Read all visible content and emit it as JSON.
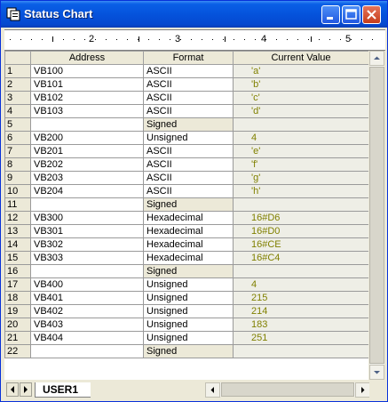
{
  "window": {
    "title": "Status Chart"
  },
  "ruler": {
    "labels": [
      "2",
      "3",
      "4",
      "5"
    ]
  },
  "grid": {
    "headers": [
      "Address",
      "Format",
      "Current Value"
    ],
    "rows": [
      {
        "n": "1",
        "address": "VB100",
        "format": "ASCII",
        "value": "'a'"
      },
      {
        "n": "2",
        "address": "VB101",
        "format": "ASCII",
        "value": "'b'"
      },
      {
        "n": "3",
        "address": "VB102",
        "format": "ASCII",
        "value": "'c'"
      },
      {
        "n": "4",
        "address": "VB103",
        "format": "ASCII",
        "value": "'d'"
      },
      {
        "n": "5",
        "address": "",
        "format": "Signed",
        "value": ""
      },
      {
        "n": "6",
        "address": "VB200",
        "format": "Unsigned",
        "value": "4"
      },
      {
        "n": "7",
        "address": "VB201",
        "format": "ASCII",
        "value": "'e'"
      },
      {
        "n": "8",
        "address": "VB202",
        "format": "ASCII",
        "value": "'f'"
      },
      {
        "n": "9",
        "address": "VB203",
        "format": "ASCII",
        "value": "'g'"
      },
      {
        "n": "10",
        "address": "VB204",
        "format": "ASCII",
        "value": "'h'"
      },
      {
        "n": "11",
        "address": "",
        "format": "Signed",
        "value": ""
      },
      {
        "n": "12",
        "address": "VB300",
        "format": "Hexadecimal",
        "value": "16#D6"
      },
      {
        "n": "13",
        "address": "VB301",
        "format": "Hexadecimal",
        "value": "16#D0"
      },
      {
        "n": "14",
        "address": "VB302",
        "format": "Hexadecimal",
        "value": "16#CE"
      },
      {
        "n": "15",
        "address": "VB303",
        "format": "Hexadecimal",
        "value": "16#C4"
      },
      {
        "n": "16",
        "address": "",
        "format": "Signed",
        "value": ""
      },
      {
        "n": "17",
        "address": "VB400",
        "format": "Unsigned",
        "value": "4"
      },
      {
        "n": "18",
        "address": "VB401",
        "format": "Unsigned",
        "value": "215"
      },
      {
        "n": "19",
        "address": "VB402",
        "format": "Unsigned",
        "value": "214"
      },
      {
        "n": "20",
        "address": "VB403",
        "format": "Unsigned",
        "value": "183"
      },
      {
        "n": "21",
        "address": "VB404",
        "format": "Unsigned",
        "value": "251"
      },
      {
        "n": "22",
        "address": "",
        "format": "Signed",
        "value": ""
      }
    ]
  },
  "tabs": [
    {
      "label": "USER1"
    }
  ],
  "colors": {
    "title_bar": "#0553dc",
    "value_text": "#808000",
    "grid_gray": "#ece9d8"
  },
  "icons": [
    "status-chart-app-icon",
    "minimize-icon",
    "maximize-icon",
    "close-icon",
    "scroll-up-icon",
    "scroll-down-icon",
    "scroll-left-icon",
    "scroll-right-icon",
    "tab-first-icon",
    "tab-next-icon"
  ]
}
